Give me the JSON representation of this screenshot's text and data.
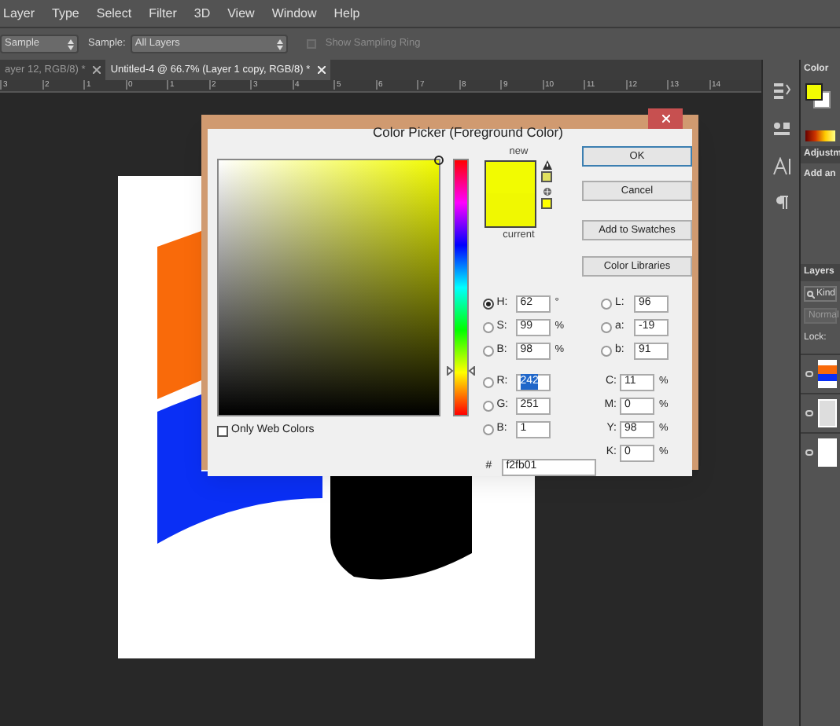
{
  "menu": [
    "Layer",
    "Type",
    "Select",
    "Filter",
    "3D",
    "View",
    "Window",
    "Help"
  ],
  "options_bar": {
    "sample_size": "Sample",
    "sample_label": "Sample:",
    "sample": "All Layers",
    "sampling_ring": {
      "label": "Show Sampling Ring",
      "checked": false,
      "disabled": true
    }
  },
  "tabs": [
    {
      "label": "ayer 12, RGB/8) *",
      "selected": false
    },
    {
      "label": "Untitled-4 @ 66.7% (Layer 1 copy, RGB/8) *",
      "selected": true
    }
  ],
  "ruler": [
    "3",
    "2",
    "1",
    "0",
    "1",
    "2",
    "3",
    "4",
    "5",
    "6",
    "7",
    "8",
    "9",
    "10",
    "11",
    "12",
    "13",
    "14"
  ],
  "right_panel": {
    "color_tab": "Color",
    "adjustments_tab": "Adjustm",
    "adjustments_hint": "Add an",
    "layers_tab": "Layers",
    "kind_filter": "Kind",
    "blend_mode": "Normal",
    "lock_label": "Lock:"
  },
  "dialog": {
    "title": "Color Picker (Foreground Color)",
    "new_label": "new",
    "current_label": "current",
    "buttons": [
      "OK",
      "Cancel",
      "Add to Swatches",
      "Color Libraries"
    ],
    "hsb": [
      {
        "label": "H:",
        "value": "62",
        "unit": "°",
        "selected": true
      },
      {
        "label": "S:",
        "value": "99",
        "unit": "%",
        "selected": false
      },
      {
        "label": "B:",
        "value": "98",
        "unit": "%",
        "selected": false
      }
    ],
    "rgb": [
      {
        "label": "R:",
        "value": "242",
        "selected": false,
        "highlighted": true
      },
      {
        "label": "G:",
        "value": "251",
        "selected": false,
        "highlighted": false
      },
      {
        "label": "B:",
        "value": "1",
        "selected": false,
        "highlighted": false
      }
    ],
    "lab": [
      {
        "label": "L:",
        "value": "96",
        "selected": false
      },
      {
        "label": "a:",
        "value": "-19",
        "selected": false
      },
      {
        "label": "b:",
        "value": "91",
        "selected": false
      }
    ],
    "cmyk": [
      {
        "label": "C:",
        "value": "11",
        "unit": "%"
      },
      {
        "label": "M:",
        "value": "0",
        "unit": "%"
      },
      {
        "label": "Y:",
        "value": "98",
        "unit": "%"
      },
      {
        "label": "K:",
        "value": "0",
        "unit": "%"
      }
    ],
    "hue_slider": {
      "level": 0.17
    },
    "hex_label": "#",
    "hex": "f2fb01",
    "only_web_colors": {
      "label": "Only Web Colors",
      "checked": false
    }
  }
}
